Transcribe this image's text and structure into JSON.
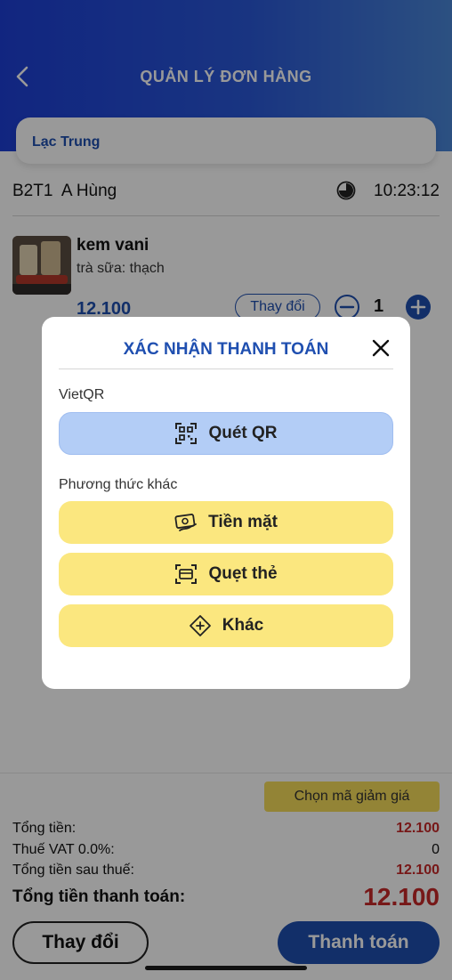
{
  "header": {
    "title": "QUẢN LÝ ĐƠN HÀNG"
  },
  "store": {
    "name": "Lạc Trung"
  },
  "table_info": {
    "label": "B2T1  A Hùng",
    "time": "10:23:12"
  },
  "product": {
    "name": "kem vani",
    "option": "trà sữa: thạch",
    "price": "12.100",
    "change_label": "Thay đổi",
    "quantity": "1"
  },
  "summary": {
    "discount_button": "Chọn mã giảm giá",
    "total_label": "Tổng tiền:",
    "total_value": "12.100",
    "vat_label": "Thuế VAT 0.0%:",
    "vat_value": "0",
    "after_tax_label": "Tổng tiền sau thuế:",
    "after_tax_value": "12.100",
    "grand_label": "Tổng tiền thanh toán:",
    "grand_value": "12.100"
  },
  "actions": {
    "change": "Thay đổi",
    "pay": "Thanh toán"
  },
  "modal": {
    "title": "XÁC NHẬN THANH TOÁN",
    "vietqr_label": "VietQR",
    "qr_button": "Quét QR",
    "other_label": "Phương thức khác",
    "cash_button": "Tiền mặt",
    "card_button": "Quẹt thẻ",
    "other_button": "Khác"
  },
  "colors": {
    "primary": "#1f4fb0",
    "accent_red": "#c62828",
    "yellow": "#fbe77f",
    "qr_blue": "#b3cdf6"
  },
  "icons": [
    "back-icon",
    "clock-icon",
    "minus-icon",
    "plus-icon",
    "close-icon",
    "qr-scan-icon",
    "cash-icon",
    "card-scan-icon",
    "diamond-plus-icon"
  ]
}
